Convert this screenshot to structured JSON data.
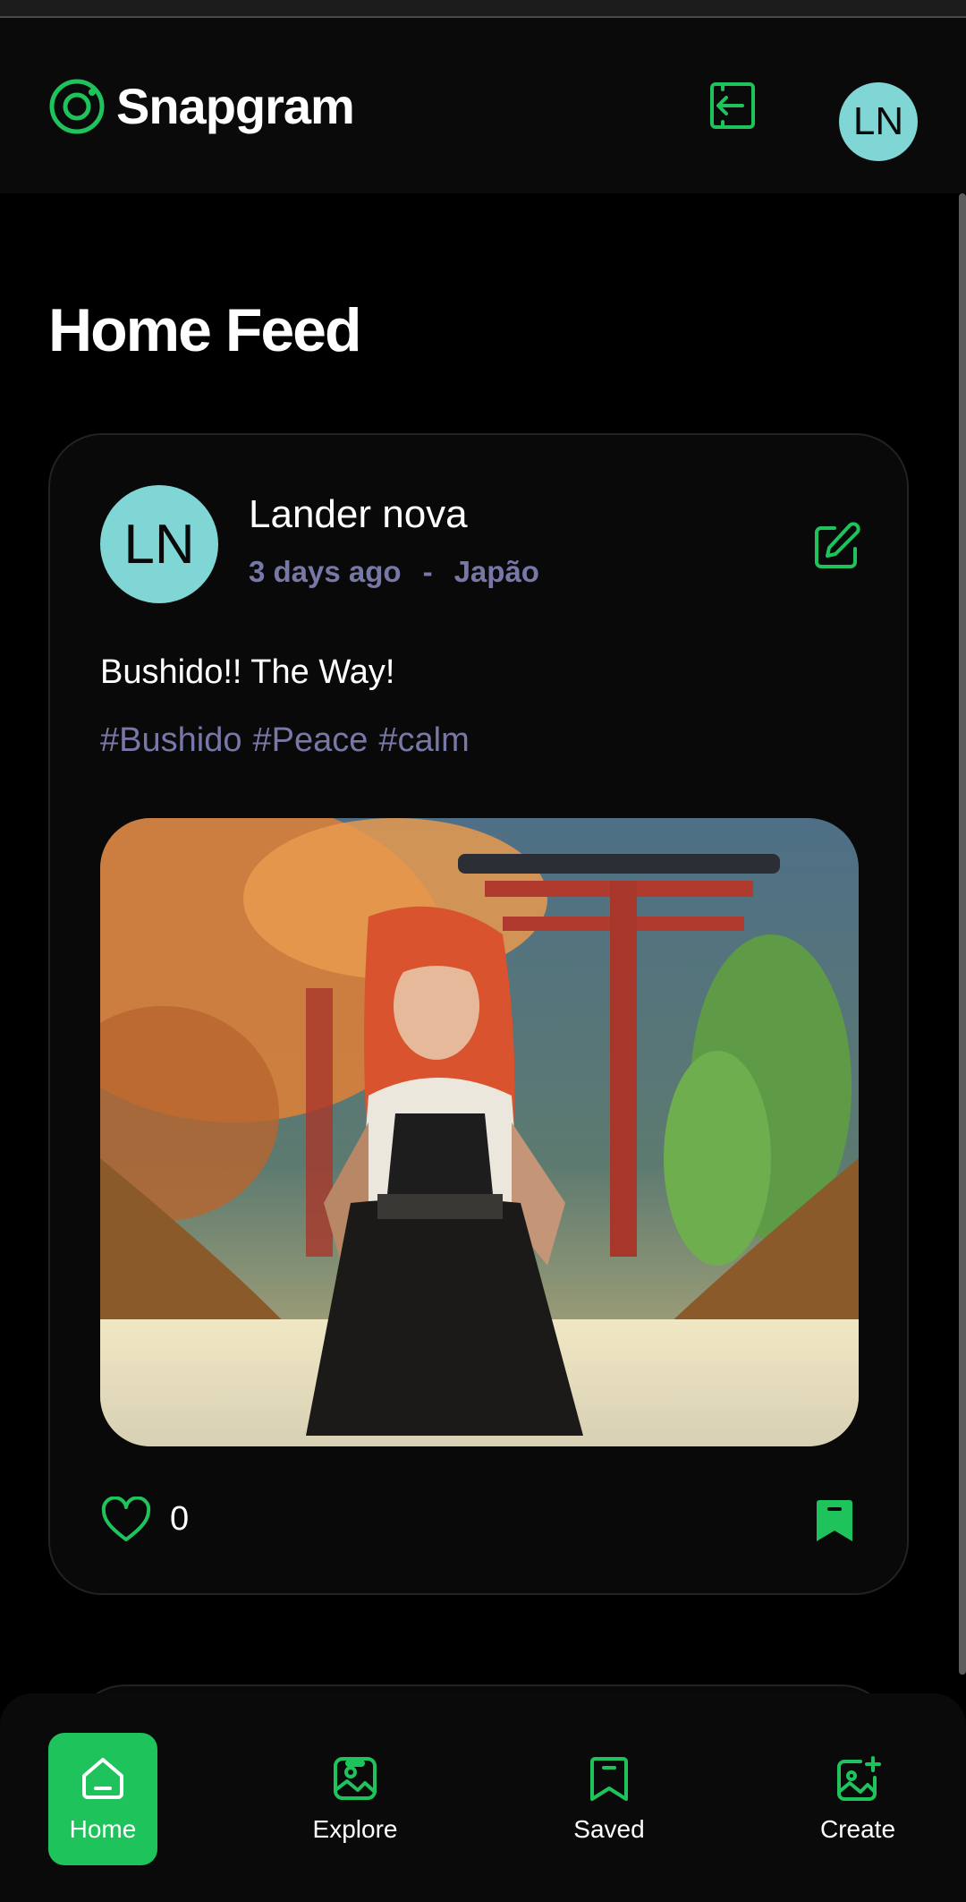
{
  "app": {
    "name": "Snapgram",
    "user_initials": "LN"
  },
  "page_title": "Home Feed",
  "colors": {
    "accent": "#1fc35c",
    "avatar_bg": "#7fd6d4",
    "muted_text": "#7878a8"
  },
  "post": {
    "author_initials": "LN",
    "author": "Lander nova",
    "time_ago": "3 days ago",
    "separator": "-",
    "location": "Japão",
    "caption": "Bushido!! The Way!",
    "tags": [
      "#Bushido",
      "#Peace",
      "#calm"
    ],
    "likes": "0"
  },
  "bottom_nav": [
    {
      "label": "Home",
      "icon": "home-icon",
      "active": true
    },
    {
      "label": "Explore",
      "icon": "explore-icon",
      "active": false
    },
    {
      "label": "Saved",
      "icon": "bookmark-icon",
      "active": false
    },
    {
      "label": "Create",
      "icon": "create-post-icon",
      "active": false
    }
  ]
}
